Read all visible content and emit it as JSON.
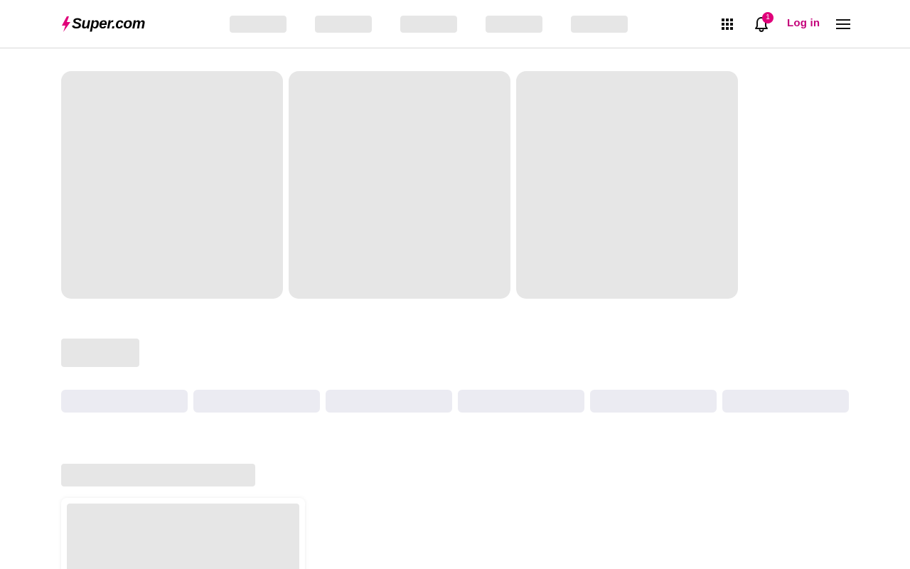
{
  "header": {
    "logo_text": "Super.com",
    "notification_count": "1",
    "login_label": "Log in",
    "icons": {
      "apps": "apps-grid-icon",
      "notifications": "bell-icon",
      "menu": "hamburger-menu-icon"
    }
  },
  "colors": {
    "brand_accent": "#e0007a",
    "login_text": "#c4007a",
    "skeleton": "#e6e6e6",
    "chip_skeleton": "#ebebf2"
  }
}
